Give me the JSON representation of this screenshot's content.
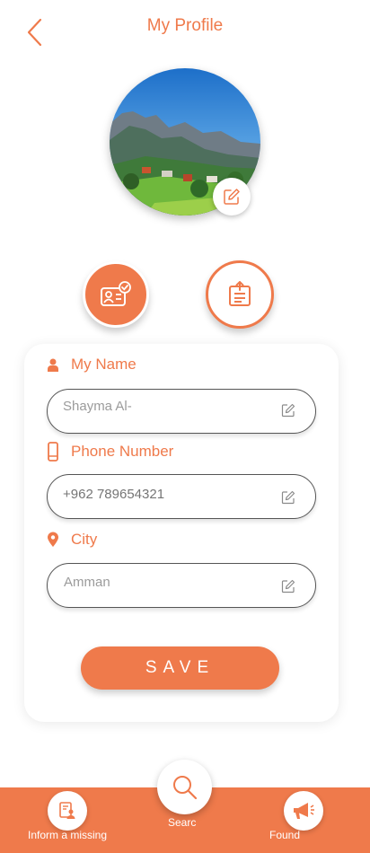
{
  "header": {
    "title": "My Profile",
    "back_icon": "chevron-left-icon"
  },
  "profile": {
    "photo_alt": "Profile photo",
    "edit_icon": "pencil-square-icon"
  },
  "mode_buttons": [
    {
      "icon": "id-card-check-icon",
      "active": true
    },
    {
      "icon": "clipboard-upload-icon",
      "active": false
    }
  ],
  "form": {
    "name": {
      "label": "My Name",
      "value": "Shayma Al-",
      "icon": "user-icon"
    },
    "phone": {
      "label": "Phone Number",
      "placeholder": "+962 789654321",
      "icon": "phone-icon"
    },
    "city": {
      "label": "City",
      "value": "Amman",
      "icon": "location-pin-icon"
    },
    "save_label": "SAVE"
  },
  "bottom_nav": {
    "items": [
      {
        "label": "Inform a missing",
        "icon": "report-user-icon"
      },
      {
        "label": "Searc",
        "icon": "search-icon"
      },
      {
        "label": "Found",
        "icon": "megaphone-icon"
      }
    ]
  },
  "colors": {
    "accent": "#ef7a4b",
    "background": "#ffffff",
    "input_text": "#9b9b9b"
  }
}
